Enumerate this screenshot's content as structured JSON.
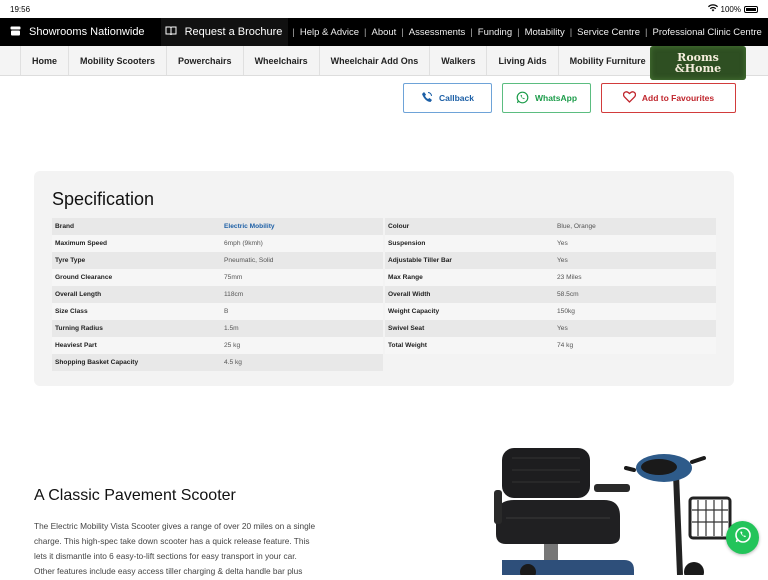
{
  "status": {
    "time": "19:56",
    "battery": "100%"
  },
  "topbar": {
    "showrooms": "Showrooms Nationwide",
    "brochure": "Request a Brochure",
    "links": [
      "Help & Advice",
      "About",
      "Assessments",
      "Funding",
      "Motability",
      "Service Centre",
      "Professional Clinic Centre"
    ]
  },
  "nav": {
    "items": [
      "Home",
      "Mobility Scooters",
      "Powerchairs",
      "Wheelchairs",
      "Wheelchair Add Ons",
      "Walkers",
      "Living Aids",
      "Mobility Furniture"
    ],
    "logo_line1": "Rooms",
    "logo_line2": "&Home"
  },
  "actions": {
    "callback": "Callback",
    "whatsapp": "WhatsApp",
    "favourites": "Add to Favourites"
  },
  "spec": {
    "title": "Specification",
    "left": [
      {
        "k": "Brand",
        "v": "Electric Mobility"
      },
      {
        "k": "Maximum Speed",
        "v": "6mph (9kmh)"
      },
      {
        "k": "Tyre Type",
        "v": "Pneumatic, Solid"
      },
      {
        "k": "Ground Clearance",
        "v": "75mm"
      },
      {
        "k": "Overall Length",
        "v": "118cm"
      },
      {
        "k": "Size Class",
        "v": "B"
      },
      {
        "k": "Turning Radius",
        "v": "1.5m"
      },
      {
        "k": "Heaviest Part",
        "v": "25 kg"
      },
      {
        "k": "Shopping Basket Capacity",
        "v": "4.5 kg"
      }
    ],
    "right": [
      {
        "k": "Colour",
        "v": "Blue, Orange"
      },
      {
        "k": "Suspension",
        "v": "Yes"
      },
      {
        "k": "Adjustable Tiller Bar",
        "v": "Yes"
      },
      {
        "k": "Max Range",
        "v": "23 Miles"
      },
      {
        "k": "Overall Width",
        "v": "58.5cm"
      },
      {
        "k": "Weight Capacity",
        "v": "150kg"
      },
      {
        "k": "Swivel Seat",
        "v": "Yes"
      },
      {
        "k": "Total Weight",
        "v": "74 kg"
      }
    ]
  },
  "classic": {
    "title": "A Classic Pavement Scooter",
    "lines": [
      "The Electric Mobility Vista Scooter gives a range of over 20 miles on a single",
      "charge. This high-spec take down scooter has a  quick release feature. This",
      "lets it dismantle into 6 easy-to-lift sections for easy transport in your car.",
      "Other features include easy access tiller charging & delta handle bar plus"
    ]
  },
  "colors": {
    "accent_blue": "#1c5fa6",
    "whatsapp_green": "#23c45a",
    "fav_red": "#c0262d"
  }
}
